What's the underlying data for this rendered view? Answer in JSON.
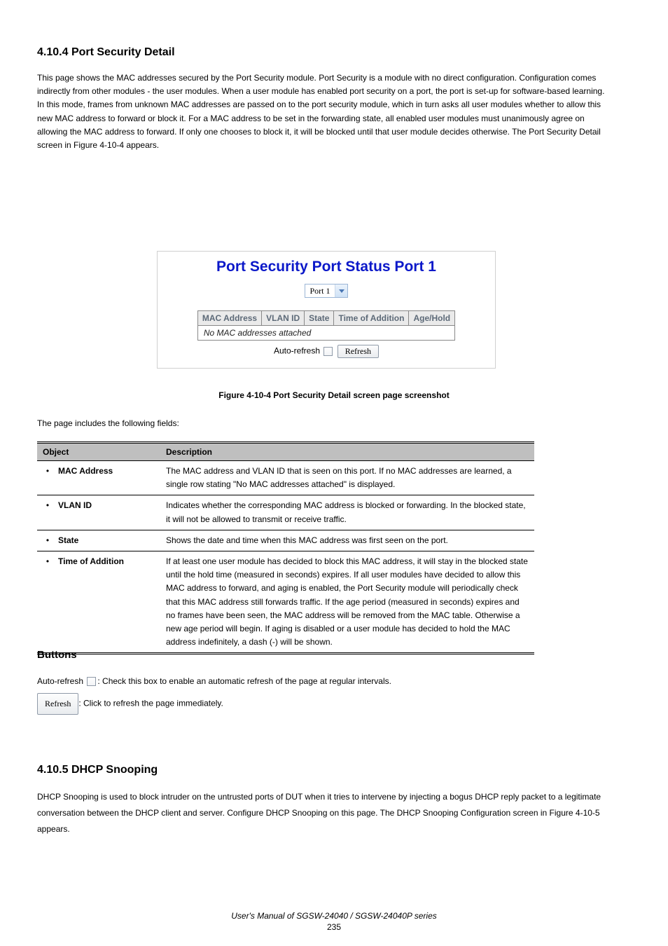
{
  "section1": {
    "number": "4.10.4",
    "title": "Port Security Detail",
    "desc_prefix": "This page shows the MAC addresses secured by the Port Security module. Port Security is a module with no direct configuration. Configuration comes indirectly from other modules - the user modules. When a user module has enabled port security on a port, the port is set-up for software-based learning. In this mode, frames from unknown MAC addresses are passed on to the port security module, which in turn asks all user modules whether to allow this new MAC address to forward or block it. For a MAC address to be set in the forwarding state, all enabled user modules must unanimously agree on allowing the MAC address to forward. If only one chooses to block it, it will be blocked until that user module decides otherwise. The Port Security Detail screen in ",
    "figref": "Figure 4-10-4",
    "desc_suffix": " appears."
  },
  "panel": {
    "title": "Port Security Port Status  Port 1",
    "port_label": "Port 1",
    "headers": [
      "MAC Address",
      "VLAN ID",
      "State",
      "Time of Addition",
      "Age/Hold"
    ],
    "empty_msg": "No MAC addresses attached",
    "auto_refresh": "Auto-refresh",
    "refresh": "Refresh"
  },
  "fig_caption": "Figure 4-10-4 Port Security Detail screen page screenshot",
  "para1": "The page includes the following fields:",
  "table": {
    "hdr_obj": "Object",
    "hdr_desc": "Description",
    "rows": [
      {
        "name": "MAC Address",
        "desc": "The MAC address and VLAN ID that is seen on this port. If no MAC addresses are learned, a single row stating \"No MAC addresses attached\" is displayed."
      },
      {
        "name": "VLAN ID",
        "desc": "Indicates whether the corresponding MAC address is blocked or forwarding. In the blocked state, it will not be allowed to transmit or receive traffic."
      },
      {
        "name": "State",
        "desc": "Shows the date and time when this MAC address was first seen on the port."
      },
      {
        "name": "Time of Addition",
        "desc": "If at least one user module has decided to block this MAC address, it will stay in the blocked state until the hold time (measured in seconds) expires. If all user modules have decided to allow this MAC address to forward, and aging is enabled, the Port Security module will periodically check that this MAC address still forwards traffic. If the age period (measured in seconds) expires and no frames have been seen, the MAC address will be removed from the MAC table. Otherwise a new age period will begin. If aging is disabled or a user module has decided to hold the MAC address indefinitely, a dash (-) will be shown."
      }
    ]
  },
  "buttons": {
    "hdr": "Buttons",
    "auto_prefix": "Auto-refresh ",
    "auto_suffix": ": Check this box to enable an automatic refresh of the page at regular intervals.",
    "refresh_suffix": ": Click to refresh the page immediately."
  },
  "section2": {
    "number": "4.10.5",
    "title": "DHCP Snooping",
    "p1": "DHCP Snooping is used to block intruder on the untrusted ports of DUT when it tries to intervene by injecting a bogus DHCP reply packet to a legitimate conversation between the DHCP client and server. Configure DHCP Snooping on this page. The DHCP Snooping Configuration screen in ",
    "figref": "Figure 4-10-5",
    "p1_suffix": " appears."
  },
  "footer": {
    "manual": "User's Manual of SGSW-24040 / SGSW-24040P series",
    "page": "235"
  }
}
